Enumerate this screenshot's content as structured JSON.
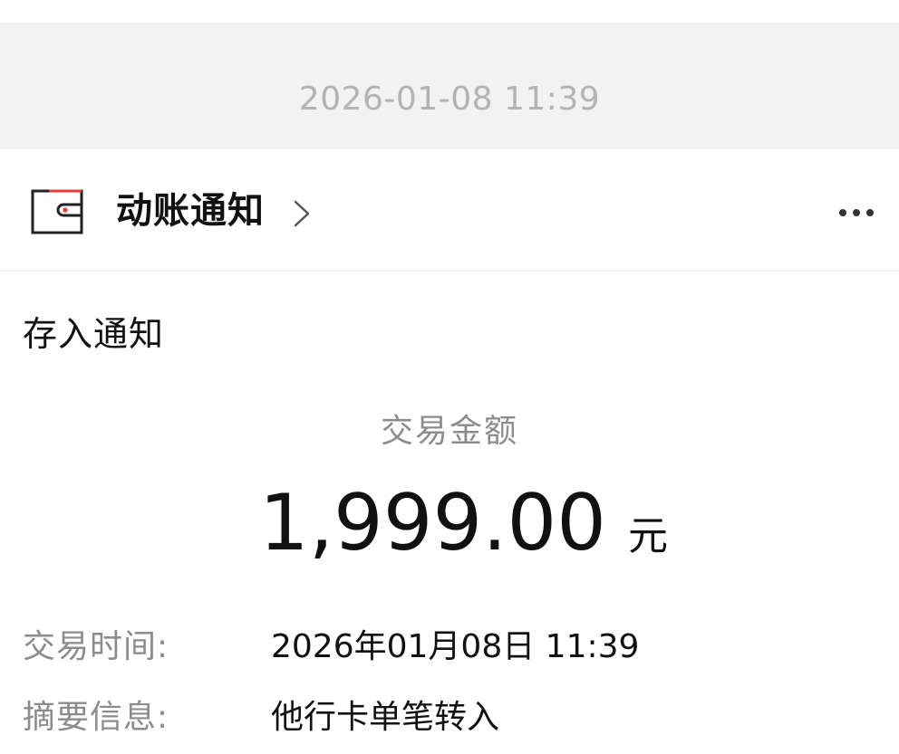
{
  "message": {
    "timestamp": "2026-01-08 11:39"
  },
  "header": {
    "account_name": "动账通知",
    "icon": "wallet-icon",
    "chevron_icon": "chevron-right-icon",
    "more_icon": "more-options-icon"
  },
  "card": {
    "title": "存入通知",
    "amount_label": "交易金额",
    "amount": "1,999.00",
    "currency_unit": "元",
    "details": [
      {
        "label": "交易时间:",
        "value": "2026年01月08日 11:39"
      },
      {
        "label": "摘要信息:",
        "value": "他行卡单笔转入"
      }
    ]
  },
  "colors": {
    "timestamp_bar_bg": "#f2f2f2",
    "timestamp_text": "#b3b3b3",
    "label_gray": "#8c8c8c",
    "primary_text": "#111111",
    "icon_accent_red": "#e23b3b"
  }
}
